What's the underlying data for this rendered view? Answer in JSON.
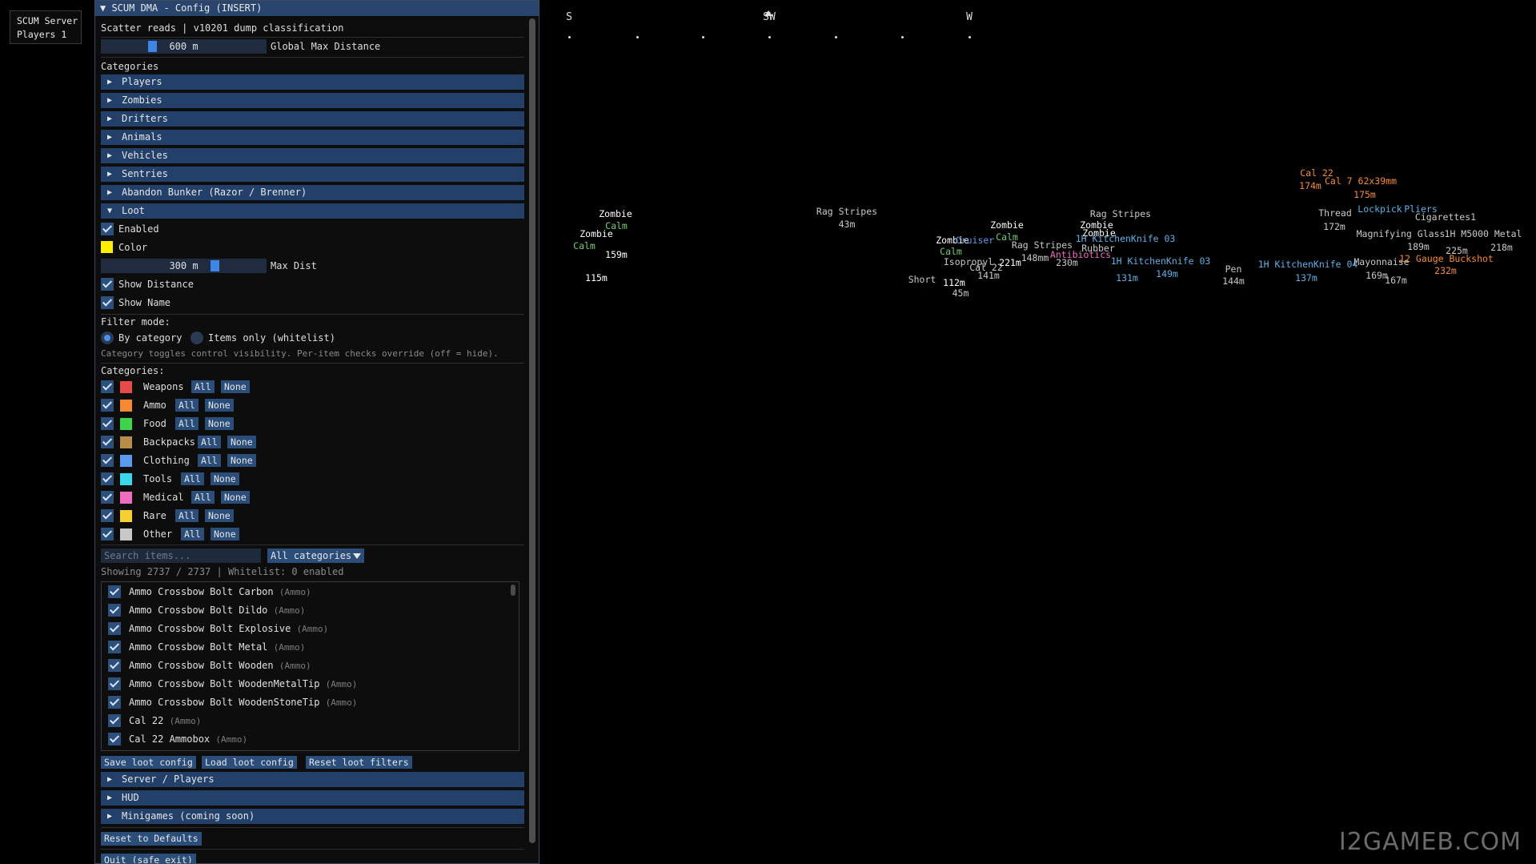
{
  "server": {
    "name": "SCUM Server",
    "players": "Players 1"
  },
  "compass": {
    "s": "S",
    "sw": "SW",
    "w": "W"
  },
  "panel": {
    "title": "▼ SCUM DMA - Config (INSERT)",
    "info": "Scatter reads | v10201 dump classification",
    "global_max": {
      "value": "600 m",
      "label": "Global Max Distance",
      "level": 0.3
    },
    "categories_label": "Categories",
    "sections": [
      "Players",
      "Zombies",
      "Drifters",
      "Animals",
      "Vehicles",
      "Sentries",
      "Abandon Bunker (Razor / Brenner)",
      "Loot"
    ],
    "loot": {
      "enabled": "Enabled",
      "color": "Color",
      "color_value": "#ffee00",
      "max_dist": {
        "value": "300 m",
        "label": "Max Dist",
        "level": 0.7
      },
      "show_distance": "Show Distance",
      "show_name": "Show Name",
      "filter_mode": "Filter mode:",
      "by_category": "By category",
      "items_only": "Items only (whitelist)",
      "hint": "Category toggles control visibility. Per-item checks override (off = hide).",
      "categories_label": "Categories:",
      "all": "All",
      "none": "None",
      "cats": [
        {
          "name": "Weapons",
          "color": "#e84a4a"
        },
        {
          "name": "Ammo",
          "color": "#f58a32"
        },
        {
          "name": "Food",
          "color": "#3fd44a"
        },
        {
          "name": "Backpacks",
          "color": "#b98c49"
        },
        {
          "name": "Clothing",
          "color": "#5a9af0"
        },
        {
          "name": "Tools",
          "color": "#3ad8ea"
        },
        {
          "name": "Medical",
          "color": "#f06cc0"
        },
        {
          "name": "Rare",
          "color": "#f5d030"
        },
        {
          "name": "Other",
          "color": "#c8c8c8"
        }
      ],
      "search_placeholder": "Search items...",
      "category_filter": "All categories",
      "showing": "Showing 2737 / 2737 | Whitelist: 0 enabled",
      "items": [
        {
          "name": "Ammo Crossbow Bolt Carbon",
          "cat": "(Ammo)"
        },
        {
          "name": "Ammo Crossbow Bolt Dildo",
          "cat": "(Ammo)"
        },
        {
          "name": "Ammo Crossbow Bolt Explosive",
          "cat": "(Ammo)"
        },
        {
          "name": "Ammo Crossbow Bolt Metal",
          "cat": "(Ammo)"
        },
        {
          "name": "Ammo Crossbow Bolt Wooden",
          "cat": "(Ammo)"
        },
        {
          "name": "Ammo Crossbow Bolt WoodenMetalTip",
          "cat": "(Ammo)"
        },
        {
          "name": "Ammo Crossbow Bolt WoodenStoneTip",
          "cat": "(Ammo)"
        },
        {
          "name": "Cal 22",
          "cat": "(Ammo)"
        },
        {
          "name": "Cal 22 Ammobox",
          "cat": "(Ammo)"
        }
      ],
      "save": "Save loot config",
      "load": "Load loot config",
      "reset": "Reset loot filters"
    },
    "bottom_sections": [
      "Server / Players",
      "HUD",
      "Minigames (coming soon)"
    ],
    "reset_defaults": "Reset to Defaults",
    "cut_button": "Quit (safe exit)"
  },
  "esp_labels": [
    {
      "t": "Zombie",
      "c": "#ffffff"
    },
    {
      "t": "Calm",
      "c": "#6fd06f"
    },
    {
      "t": "Zombie",
      "c": "#ffffff"
    },
    {
      "t": "Calm",
      "c": "#6fd06f"
    },
    {
      "t": "159m",
      "c": "#ffffff"
    },
    {
      "t": "115m",
      "c": "#ffffff"
    },
    {
      "t": "Rag Stripes",
      "c": "#c8c8c8"
    },
    {
      "t": "43m",
      "c": "#c8c8c8"
    },
    {
      "t": "Zombie",
      "c": "#ffffff"
    },
    {
      "t": "Calm",
      "c": "#6fd06f"
    },
    {
      "t": "Zombie",
      "c": "#ffffff"
    },
    {
      "t": "Calm",
      "c": "#6fd06f"
    },
    {
      "t": "Cruiser",
      "c": "#5a9af0"
    },
    {
      "t": "Isopropyl",
      "c": "#c8c8c8"
    },
    {
      "t": "221m",
      "c": "#ffffff"
    },
    {
      "t": "Short",
      "c": "#c8c8c8"
    },
    {
      "t": "112m",
      "c": "#ffffff"
    },
    {
      "t": "45m",
      "c": "#c8c8c8"
    },
    {
      "t": "Cal 22",
      "c": "#c8c8c8"
    },
    {
      "t": "141m",
      "c": "#c8c8c8"
    },
    {
      "t": "Rag Stripes",
      "c": "#c8c8c8"
    },
    {
      "t": "148mm",
      "c": "#c8c8c8"
    },
    {
      "t": "Zombie",
      "c": "#ffffff"
    },
    {
      "t": "Zombie",
      "c": "#ffffff"
    },
    {
      "t": "Rag Stripes",
      "c": "#c8c8c8"
    },
    {
      "t": "1H KitchenKnife 03",
      "c": "#5ab0e8"
    },
    {
      "t": "Antibiotics",
      "c": "#f06cc0"
    },
    {
      "t": "230m",
      "c": "#c8c8c8"
    },
    {
      "t": "Rubber",
      "c": "#c8c8c8"
    },
    {
      "t": "1H KitchenKnife 03",
      "c": "#5ab0e8"
    },
    {
      "t": "131m",
      "c": "#5ab0e8"
    },
    {
      "t": "149m",
      "c": "#5ab0e8"
    },
    {
      "t": "Pen",
      "c": "#c8c8c8"
    },
    {
      "t": "144m",
      "c": "#c8c8c8"
    },
    {
      "t": "Cal 22",
      "c": "#f58a32"
    },
    {
      "t": "174m",
      "c": "#f58a32"
    },
    {
      "t": "Cal 7 62x39mm",
      "c": "#f58a32"
    },
    {
      "t": "175m",
      "c": "#f58a32"
    },
    {
      "t": "Thread",
      "c": "#c8c8c8"
    },
    {
      "t": "172m",
      "c": "#c8c8c8"
    },
    {
      "t": "Lockpick",
      "c": "#5ab0e8"
    },
    {
      "t": "Pliers",
      "c": "#5ab0e8"
    },
    {
      "t": "Cigarettes1",
      "c": "#c8c8c8"
    },
    {
      "t": "Magnifying Glass",
      "c": "#c8c8c8"
    },
    {
      "t": "1H M5000 Metal",
      "c": "#c8c8c8"
    },
    {
      "t": "189m",
      "c": "#c8c8c8"
    },
    {
      "t": "225m",
      "c": "#c8c8c8"
    },
    {
      "t": "218m",
      "c": "#c8c8c8"
    },
    {
      "t": "1H KitchenKnife 04",
      "c": "#5ab0e8"
    },
    {
      "t": "137m",
      "c": "#5ab0e8"
    },
    {
      "t": "Mayonnaise",
      "c": "#c8c8c8"
    },
    {
      "t": "169m",
      "c": "#c8c8c8"
    },
    {
      "t": "12 Gauge Buckshot",
      "c": "#f58a32"
    },
    {
      "t": "232m",
      "c": "#f58a32"
    },
    {
      "t": "167m",
      "c": "#c8c8c8"
    }
  ],
  "watermark": "I2GAMEB.COM"
}
